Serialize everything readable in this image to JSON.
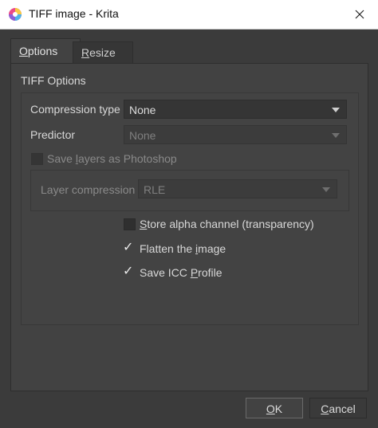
{
  "window": {
    "title": "TIFF image - Krita"
  },
  "tabs": [
    {
      "label": "Options",
      "mnemonic": "O",
      "rest": "ptions",
      "active": true
    },
    {
      "label": "Resize",
      "mnemonic": "R",
      "rest": "esize",
      "active": false
    }
  ],
  "options": {
    "group_title": "TIFF Options",
    "compression": {
      "label": "Compression type",
      "value": "None"
    },
    "predictor": {
      "label": "Predictor",
      "value": "None"
    },
    "save_layers": {
      "label_pre": "Save ",
      "label_mn": "l",
      "label_post": "ayers as Photoshop",
      "checked": false
    },
    "layer_compression": {
      "label": "Layer compression",
      "value": "RLE"
    },
    "store_alpha": {
      "label_mn": "S",
      "label_post": "tore alpha channel (transparency)",
      "checked": false
    },
    "flatten": {
      "label_pre": "Flatten the ",
      "label_mn": "i",
      "label_post": "mage",
      "checked": true
    },
    "icc": {
      "label_pre": "Save ICC ",
      "label_mn": "P",
      "label_post": "rofile",
      "checked": true
    }
  },
  "buttons": {
    "ok": {
      "mnemonic": "O",
      "rest": "K"
    },
    "cancel": {
      "mnemonic": "C",
      "rest": "ancel"
    }
  },
  "icons": {
    "app": "krita-logo-icon",
    "close": "close-icon",
    "dropdown": "chevron-down-icon",
    "check": "checkmark-icon"
  },
  "colors": {
    "background": "#3b3b3b",
    "panel": "#424242",
    "titlebar": "#ffffff",
    "text": "#d8d8d8",
    "disabled_text": "#8a8a8a"
  }
}
